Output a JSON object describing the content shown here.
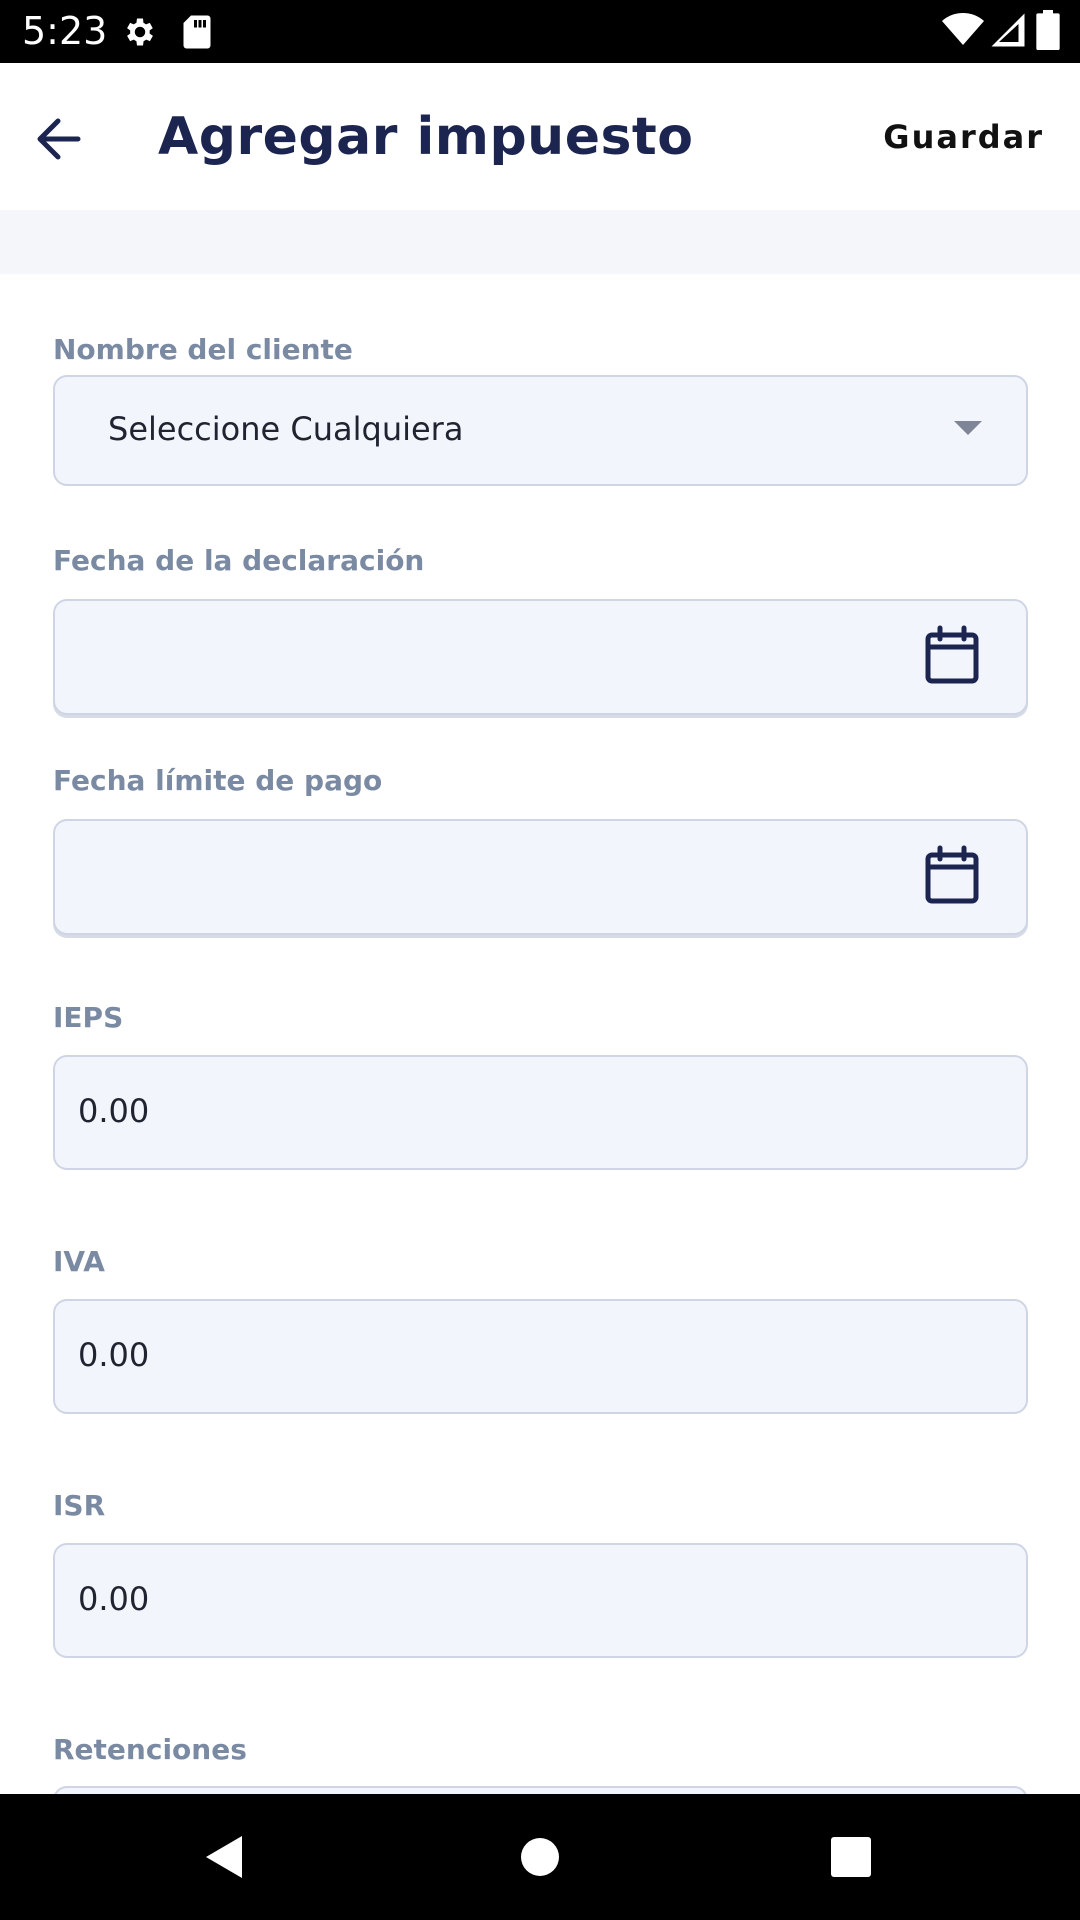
{
  "status_bar": {
    "time": "5:23",
    "icons": [
      "settings-icon",
      "sd-card-icon",
      "wifi-icon",
      "cellular-signal-icon",
      "battery-icon"
    ]
  },
  "app_bar": {
    "title": "Agregar impuesto",
    "save_label": "Guardar",
    "back_icon": "arrow-left-icon"
  },
  "form": {
    "client": {
      "label": "Nombre del cliente",
      "value": "Seleccione Cualquiera"
    },
    "declaration_date": {
      "label": "Fecha de la declaración",
      "value": ""
    },
    "payment_deadline": {
      "label": "Fecha límite de pago",
      "value": ""
    },
    "ieps": {
      "label": "IEPS",
      "value": "0.00"
    },
    "iva": {
      "label": "IVA",
      "value": "0.00"
    },
    "isr": {
      "label": "ISR",
      "value": "0.00"
    },
    "retenciones": {
      "label": "Retenciones"
    }
  },
  "colors": {
    "title": "#1c2550",
    "label": "#7b8aa3",
    "field_bg": "#f2f5fc",
    "field_border": "#cfd5e4"
  },
  "nav_bar": {
    "icons": [
      "back-triangle-icon",
      "home-circle-icon",
      "recents-square-icon"
    ]
  }
}
